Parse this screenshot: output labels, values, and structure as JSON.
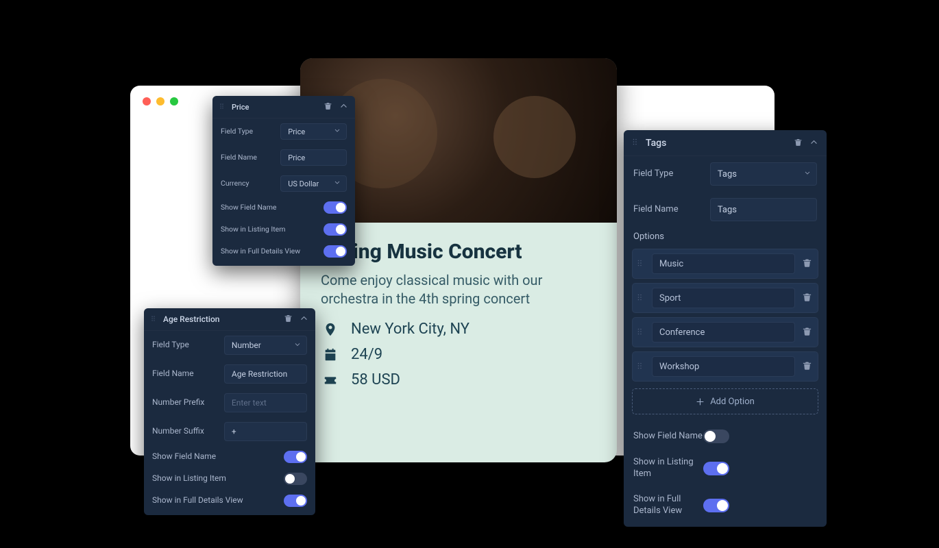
{
  "listing": {
    "title": "Spring Music Concert",
    "description": "Come enjoy classical music with our orchestra in the 4th spring concert",
    "location": "New York City, NY",
    "date": "24/9",
    "price": "58 USD"
  },
  "panels": {
    "price": {
      "title": "Price",
      "field_type_label": "Field Type",
      "field_type_value": "Price",
      "field_name_label": "Field Name",
      "field_name_value": "Price",
      "currency_label": "Currency",
      "currency_value": "US Dollar",
      "show_field_name_label": "Show Field Name",
      "show_in_listing_label": "Show in Listing Item",
      "show_in_full_label": "Show in Full Details View"
    },
    "age": {
      "title": "Age Restriction",
      "field_type_label": "Field Type",
      "field_type_value": "Number",
      "field_name_label": "Field Name",
      "field_name_value": "Age Restriction",
      "prefix_label": "Number Prefix",
      "prefix_placeholder": "Enter text",
      "suffix_label": "Number Suffix",
      "suffix_value": "+",
      "show_field_name_label": "Show Field Name",
      "show_in_listing_label": "Show in Listing Item",
      "show_in_full_label": "Show in Full Details View"
    },
    "tags": {
      "title": "Tags",
      "field_type_label": "Field Type",
      "field_type_value": "Tags",
      "field_name_label": "Field Name",
      "field_name_value": "Tags",
      "options_label": "Options",
      "options": {
        "o0": "Music",
        "o1": "Sport",
        "o2": "Conference",
        "o3": "Workshop"
      },
      "add_option_label": "Add Option",
      "show_field_name_label": "Show Field Name",
      "show_in_listing_label": "Show in Listing Item",
      "show_in_full_label": "Show in Full Details View"
    }
  }
}
